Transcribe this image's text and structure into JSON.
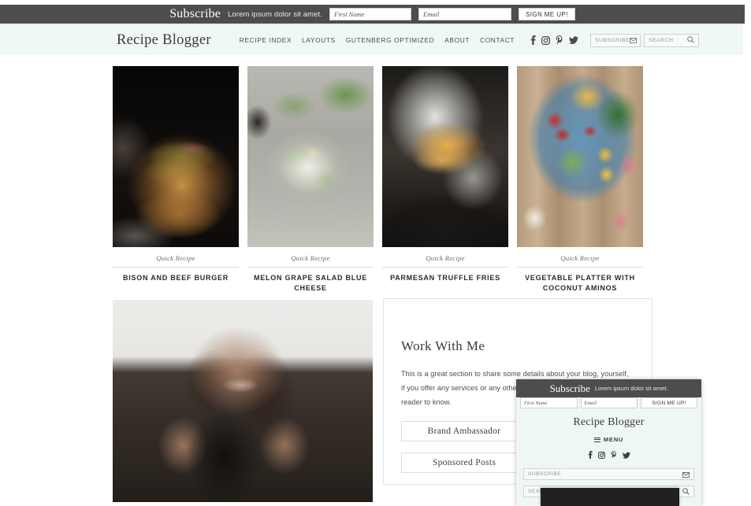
{
  "top_subscribe_bar": {
    "title": "Subscribe",
    "tagline": "Lorem ipsum dolor sit amet.",
    "first_name_placeholder": "First Name",
    "email_placeholder": "Email",
    "button_label": "SIGN ME UP!",
    "background": "#4d4d4d"
  },
  "nav": {
    "brand": "Recipe Blogger",
    "background": "#f0f8f4",
    "links": [
      {
        "label": "RECIPE INDEX"
      },
      {
        "label": "LAYOUTS"
      },
      {
        "label": "GUTENBERG OPTIMIZED"
      },
      {
        "label": "ABOUT"
      },
      {
        "label": "CONTACT"
      }
    ],
    "social": [
      {
        "name": "facebook-icon"
      },
      {
        "name": "instagram-icon"
      },
      {
        "name": "pinterest-icon"
      },
      {
        "name": "twitter-icon"
      }
    ],
    "subscribe_widget": {
      "label": "SUBSCRIBE",
      "icon": "envelope-icon"
    },
    "search_widget": {
      "label": "SEARCH",
      "icon": "search-icon"
    }
  },
  "recipe_grid": {
    "cards": [
      {
        "category": "Quick Recipe",
        "title": "BISON AND BEEF BURGER",
        "photo": "dark-burger-on-board"
      },
      {
        "category": "Quick Recipe",
        "title": "MELON GRAPE SALAD BLUE CHEESE",
        "photo": "salad-bowl-with-feta"
      },
      {
        "category": "Quick Recipe",
        "title": "PARMESAN TRUFFLE FRIES",
        "photo": "fries-in-newspaper-cone"
      },
      {
        "category": "Quick Recipe",
        "title": "VEGETABLE PLATTER WITH COCONUT AMINOS",
        "photo": "veggie-platter-blue-plate"
      }
    ]
  },
  "bottom_row": {
    "portrait_photo": "smiling-woman-grayscale-portrait",
    "work_with_me": {
      "heading": "Work With Me",
      "paragraph": "This is a great section to share some details about your blog, yourself, if you offer any services or any other details that are important for your reader to know.",
      "buttons": [
        {
          "label": "Brand Ambassador"
        },
        {
          "label": "Sponsored Posts"
        }
      ]
    }
  },
  "mobile_overlay": {
    "subscribe": {
      "title": "Subscribe",
      "tagline": "Lorem ipsum dolor sit amet.",
      "first_name_placeholder": "First Name",
      "email_placeholder": "Email",
      "button_label": "SIGN ME UP!"
    },
    "brand": "Recipe Blogger",
    "menu_label": "MENU",
    "social": [
      {
        "name": "facebook-icon"
      },
      {
        "name": "instagram-icon"
      },
      {
        "name": "pinterest-icon"
      },
      {
        "name": "twitter-icon"
      }
    ],
    "subscribe_widget": {
      "label": "SUBSCRIBE",
      "icon": "envelope-icon"
    },
    "search_widget": {
      "label": "SEARCH",
      "icon": "search-icon"
    }
  }
}
